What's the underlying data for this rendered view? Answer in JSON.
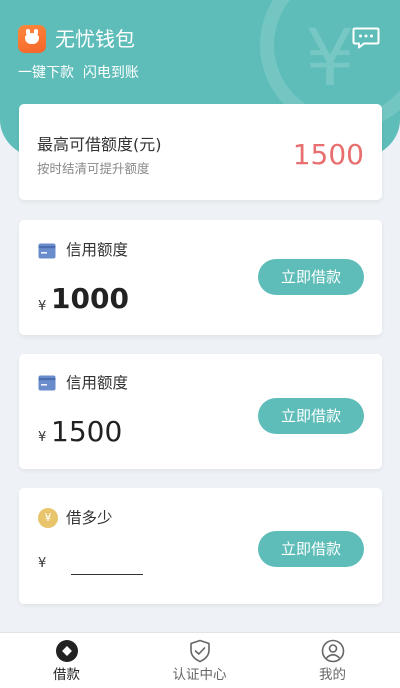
{
  "header": {
    "app_title": "无忧钱包",
    "slogan": "一键下款  闪电到账",
    "message_icon": "chat-bubble-icon",
    "watermark_glyph": "¥"
  },
  "max_card": {
    "title": "最高可借额度(元)",
    "subtitle": "按时结清可提升额度",
    "amount": "1500"
  },
  "loan_cards": [
    {
      "label": "信用额度",
      "currency": "¥",
      "amount": "1000",
      "button": "立即借款",
      "icon": "credit-card-icon"
    },
    {
      "label": "信用额度",
      "currency": "¥",
      "amount": "1500",
      "button": "立即借款",
      "icon": "credit-card-icon"
    }
  ],
  "custom_card": {
    "label": "借多少",
    "currency": "¥",
    "coin_glyph": "¥",
    "input_value": "",
    "button": "立即借款",
    "icon": "coin-icon"
  },
  "tabbar": {
    "items": [
      {
        "label": "借款",
        "icon": "loan-diamond-icon",
        "active": true
      },
      {
        "label": "认证中心",
        "icon": "shield-check-icon",
        "active": false
      },
      {
        "label": "我的",
        "icon": "profile-icon",
        "active": false
      }
    ]
  },
  "colors": {
    "accent": "#5ebdb9",
    "highlight_amount": "#e86f6f",
    "background": "#eef1f5",
    "card_icon": "#6a8ccc",
    "coin": "#e8c56b"
  }
}
